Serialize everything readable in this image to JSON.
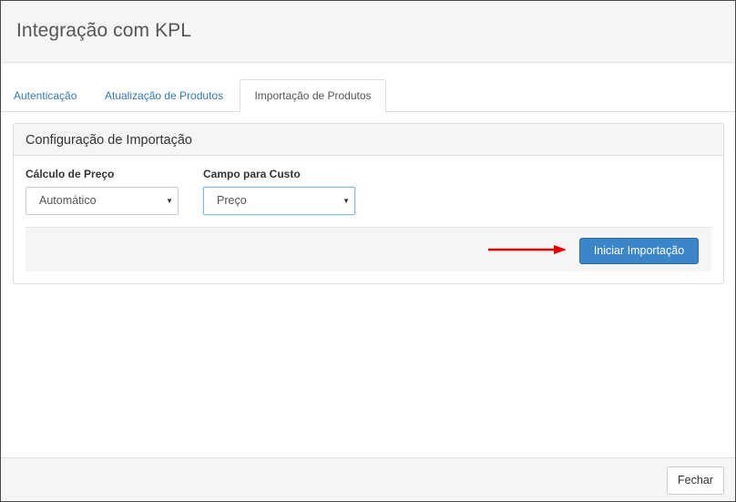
{
  "modal": {
    "title": "Integração com KPL"
  },
  "tabs": [
    {
      "label": "Autenticação",
      "active": false
    },
    {
      "label": "Atualização de Produtos",
      "active": false
    },
    {
      "label": "Importação de Produtos",
      "active": true
    }
  ],
  "panel": {
    "heading": "Configuração de Importação",
    "fields": [
      {
        "label": "Cálculo de Preço",
        "value": "Automático"
      },
      {
        "label": "Campo para Custo",
        "value": "Preço"
      }
    ],
    "caret_icon": "caret-down-icon",
    "start_button_label": "Iniciar Importação",
    "arrow_icon": "red-arrow-right-icon"
  },
  "footer": {
    "close_label": "Fechar"
  },
  "colors": {
    "primary": "#3a86c8",
    "link": "#337ab7",
    "arrow": "#e60000"
  }
}
